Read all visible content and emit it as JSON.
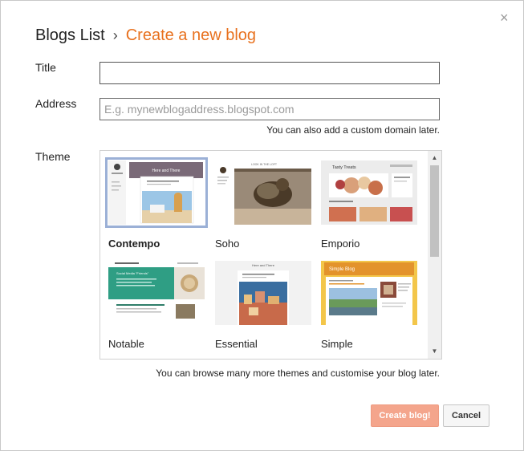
{
  "dialog": {
    "close_label": "×"
  },
  "breadcrumb": {
    "parent": "Blogs List",
    "separator": "›",
    "current": "Create a new blog"
  },
  "form": {
    "title_label": "Title",
    "title_value": "",
    "address_label": "Address",
    "address_value": "",
    "address_placeholder": "E.g. mynewblogaddress.blogspot.com",
    "address_hint": "You can also add a custom domain later.",
    "theme_label": "Theme",
    "theme_hint": "You can browse many more themes and customise your blog later."
  },
  "themes": [
    {
      "name": "Contempo",
      "selected": true,
      "thumb_header": "Here and There",
      "accent": "#7a6a78"
    },
    {
      "name": "Soho",
      "selected": false,
      "thumb_header": "LOOK IN THE LOFT",
      "accent": "#8a6a4a"
    },
    {
      "name": "Emporio",
      "selected": false,
      "thumb_header": "Tasty Treats",
      "accent": "#d06060"
    },
    {
      "name": "Notable",
      "selected": false,
      "thumb_header": "Social Media \"Friends\"",
      "accent": "#2f9e84"
    },
    {
      "name": "Essential",
      "selected": false,
      "thumb_header": "Here and There",
      "accent": "#3a6ea0"
    },
    {
      "name": "Simple",
      "selected": false,
      "thumb_header": "Simple Blog",
      "accent": "#e3932c"
    }
  ],
  "scrollbar": {
    "up": "▲",
    "down": "▼"
  },
  "buttons": {
    "create": "Create blog!",
    "cancel": "Cancel"
  },
  "colors": {
    "accent_orange": "#e8711e",
    "create_button_bg": "#f4a58c",
    "selected_outline": "#9bb0d6"
  }
}
